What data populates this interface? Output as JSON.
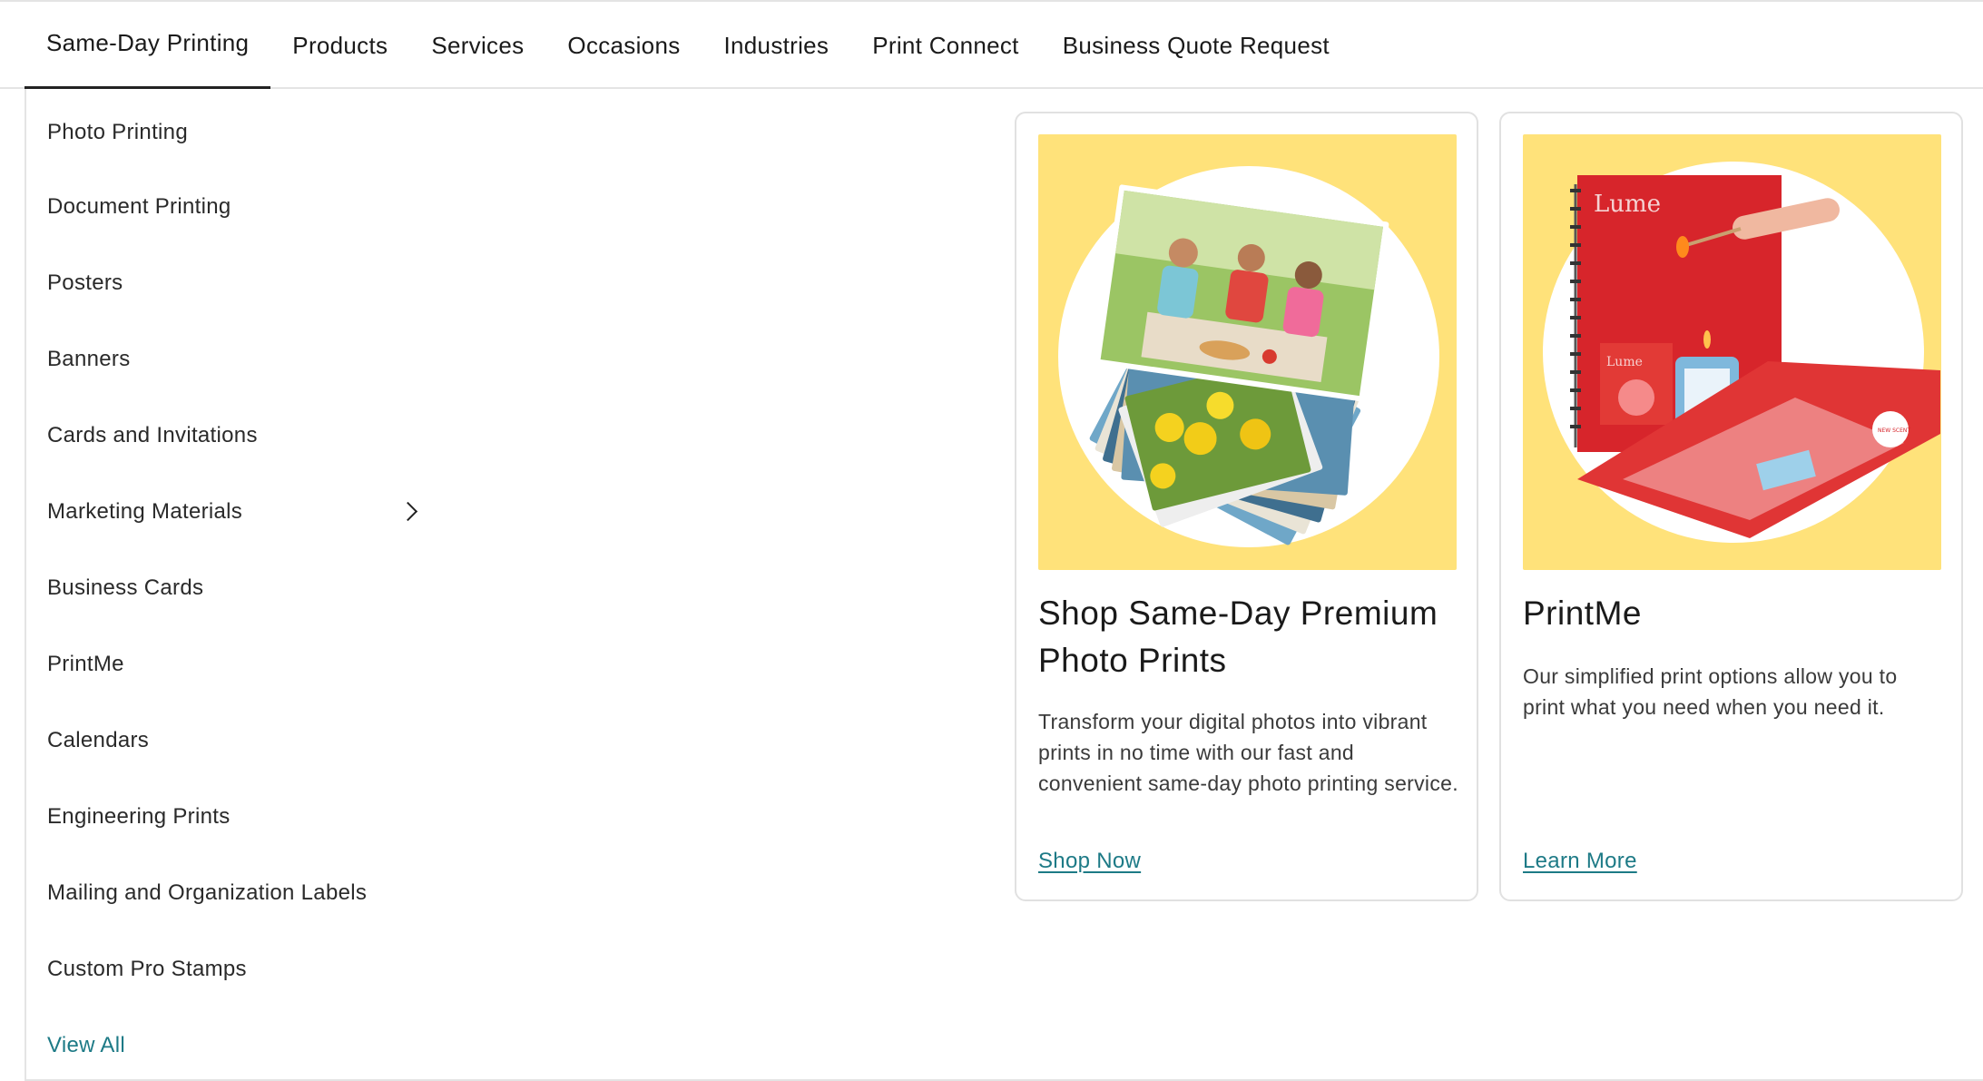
{
  "nav": {
    "tabs": [
      {
        "label": "Same-Day Printing",
        "active": true
      },
      {
        "label": "Products"
      },
      {
        "label": "Services"
      },
      {
        "label": "Occasions"
      },
      {
        "label": "Industries"
      },
      {
        "label": "Print Connect"
      },
      {
        "label": "Business Quote Request"
      }
    ]
  },
  "submenu": {
    "items": [
      {
        "label": "Photo Printing"
      },
      {
        "label": "Document Printing"
      },
      {
        "label": "Posters"
      },
      {
        "label": "Banners"
      },
      {
        "label": "Cards and Invitations"
      },
      {
        "label": "Marketing Materials",
        "icon": "chevron-right-icon"
      },
      {
        "label": "Business Cards"
      },
      {
        "label": "PrintMe"
      },
      {
        "label": "Calendars"
      },
      {
        "label": "Engineering Prints"
      },
      {
        "label": "Mailing and Organization Labels"
      },
      {
        "label": "Custom Pro Stamps"
      }
    ],
    "view_all": "View All"
  },
  "cards": [
    {
      "title": "Shop Same-Day Premium Photo Prints",
      "description": "Transform your digital photos into vibrant prints in no time with our fast and convenient same-day photo printing service.",
      "link": "Shop Now"
    },
    {
      "title": "PrintMe",
      "description": "Our simplified print options allow you to print what you need when you need it.",
      "link": "Learn More",
      "image_text": {
        "brand": "Lume",
        "sticker": "NEW SCENT"
      }
    }
  ],
  "colors": {
    "accent_link": "#1d7a86",
    "card_image_bg": "#ffe27a",
    "divider": "#e4e4e4"
  }
}
